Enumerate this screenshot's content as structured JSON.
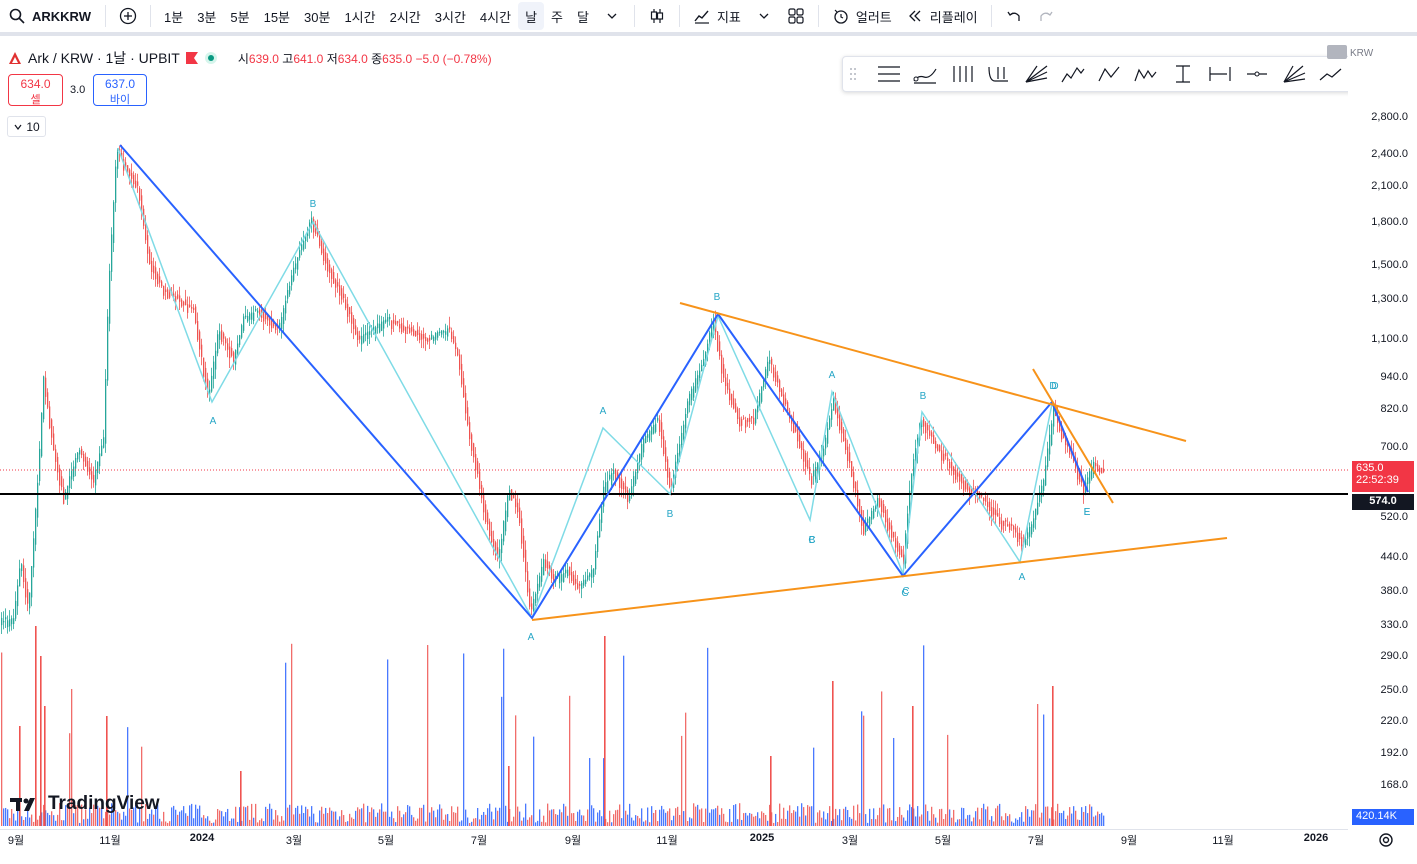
{
  "toolbar": {
    "symbol": "ARKKRW",
    "intervals": [
      "1분",
      "3분",
      "5분",
      "15분",
      "30분",
      "1시간",
      "2시간",
      "3시간",
      "4시간",
      "날",
      "주",
      "달"
    ],
    "active_interval": "날",
    "indicators_label": "지표",
    "alert_label": "얼러트",
    "replay_label": "리플레이"
  },
  "legend": {
    "title": "Ark / KRW · 1날 · UPBIT",
    "open_label": "시",
    "open": "639.0",
    "high_label": "고",
    "high": "641.0",
    "low_label": "저",
    "low": "634.0",
    "close_label": "종",
    "close": "635.0",
    "change": "−5.0 (−0.78%)"
  },
  "trade": {
    "sell_price": "634.0",
    "sell_label": "셀",
    "spread": "3.0",
    "buy_price": "637.0",
    "buy_label": "바이",
    "quantity": "10"
  },
  "currency_top": "KRW",
  "price_axis": [
    "2,800.0",
    "2,400.0",
    "2,100.0",
    "1,800.0",
    "1,500.0",
    "1,300.0",
    "1,100.0",
    "940.0",
    "820.0",
    "700.0",
    "520.0",
    "440.0",
    "380.0",
    "330.0",
    "290.0",
    "250.0",
    "220.0",
    "192.0",
    "168.0"
  ],
  "badges": {
    "last_price": "635.0",
    "countdown": "22:52:39",
    "line_price": "574.0",
    "volume": "420.14K"
  },
  "time_axis": [
    {
      "label": "9월",
      "bold": false
    },
    {
      "label": "11월",
      "bold": false
    },
    {
      "label": "2024",
      "bold": true
    },
    {
      "label": "3월",
      "bold": false
    },
    {
      "label": "5월",
      "bold": false
    },
    {
      "label": "7월",
      "bold": false
    },
    {
      "label": "9월",
      "bold": false
    },
    {
      "label": "11월",
      "bold": false
    },
    {
      "label": "2025",
      "bold": true
    },
    {
      "label": "3월",
      "bold": false
    },
    {
      "label": "5월",
      "bold": false
    },
    {
      "label": "7월",
      "bold": false
    },
    {
      "label": "9월",
      "bold": false
    },
    {
      "label": "11월",
      "bold": false
    },
    {
      "label": "2026",
      "bold": true
    }
  ],
  "brand": "TradingView",
  "wave_labels": [
    "A",
    "B",
    "A",
    "B",
    "C",
    "A",
    "B",
    "C",
    "D",
    "E",
    "A",
    "B",
    "A",
    "B",
    "C",
    "D",
    "E"
  ],
  "colors": {
    "up": "#26a69a",
    "down": "#ef5350",
    "blue_wave": "#2962ff",
    "cyan_wave": "#7fdbe6",
    "trend": "#f7931a",
    "label": "#26a6c6"
  }
}
